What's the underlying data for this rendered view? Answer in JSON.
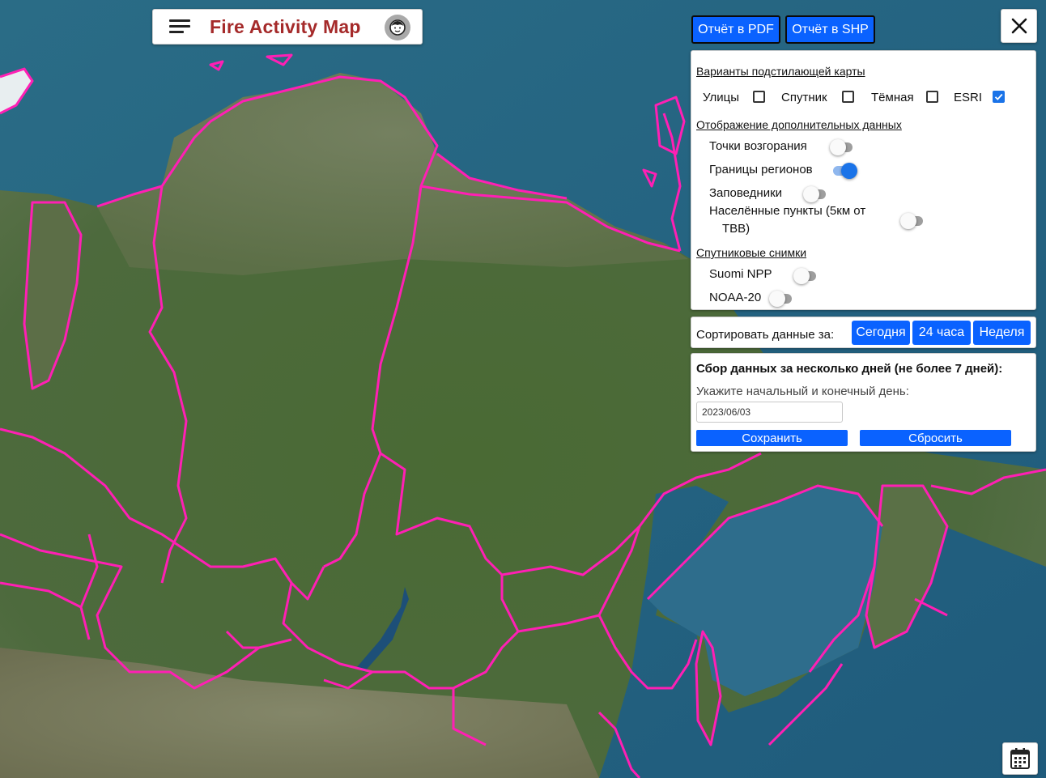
{
  "header": {
    "title": "Fire Activity Map",
    "menu_icon": "hamburger-menu-icon",
    "user_icon": "user-face-icon"
  },
  "toolbar": {
    "pdf_label": "Отчёт в PDF",
    "shp_label": "Отчёт в SHP",
    "close_icon": "close-icon"
  },
  "basemap": {
    "title": "Варианты подстилающей карты",
    "options": [
      {
        "label": "Улицы",
        "checked": false
      },
      {
        "label": "Спутник",
        "checked": false
      },
      {
        "label": "Тёмная",
        "checked": false
      },
      {
        "label": "ESRI",
        "checked": true
      }
    ]
  },
  "extra_data": {
    "title": "Отображение дополнительных данных",
    "items": [
      {
        "label": "Точки возгорания",
        "on": false
      },
      {
        "label": "Границы регионов",
        "on": true
      },
      {
        "label": "Заповедники",
        "on": false
      },
      {
        "label": "Населённые пункты (5км от",
        "label2": "ТВВ)",
        "on": false
      }
    ]
  },
  "satellite": {
    "title": "Спутниковые снимки",
    "items": [
      {
        "label": "Suomi NPP",
        "on": false
      },
      {
        "label": "NOAA-20",
        "on": false
      }
    ]
  },
  "sort": {
    "label": "Сортировать данные за:",
    "buttons": [
      "Сегодня",
      "24 часа",
      "Неделя"
    ]
  },
  "collect": {
    "title": "Сбор данных за несколько дней (не более 7 дней):",
    "hint": "Укажите начальный и конечный день:",
    "date_value": "2023/06/03",
    "save_label": "Сохранить",
    "reset_label": "Сбросить"
  },
  "calendar": {
    "icon": "calendar-icon"
  },
  "colors": {
    "title_red": "#a52a2a",
    "button_blue": "#0a62ff",
    "toggle_on": "#1a73e8",
    "region_border": "#ff1fb4",
    "sea": "#2f6a86",
    "land": "#4f6b3c"
  }
}
